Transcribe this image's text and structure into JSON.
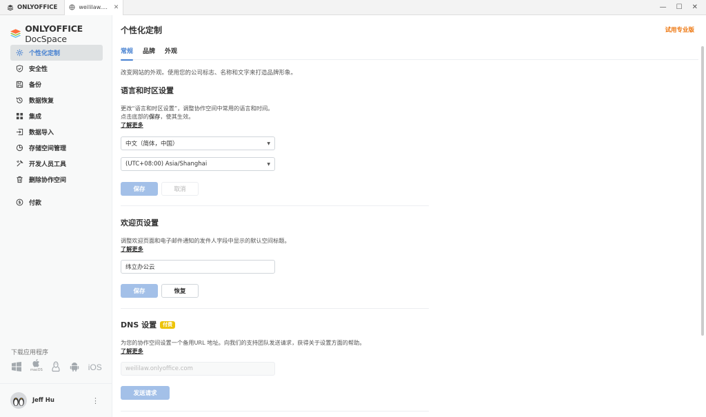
{
  "titlebar": {
    "app_name": "ONLYOFFICE",
    "tab_title": "weililaw.onlyo...",
    "tab_close": "✕",
    "min": "—",
    "max": "☐",
    "close": "✕"
  },
  "sidebar": {
    "logo_bold": "ONLYOFFICE",
    "logo_light": "DocSpace",
    "items": [
      {
        "label": "个性化定制",
        "icon": "gear-icon"
      },
      {
        "label": "安全性",
        "icon": "shield-icon"
      },
      {
        "label": "备份",
        "icon": "floppy-icon"
      },
      {
        "label": "数据恢复",
        "icon": "restore-icon"
      },
      {
        "label": "集成",
        "icon": "grid-icon"
      },
      {
        "label": "数据导入",
        "icon": "import-icon"
      },
      {
        "label": "存储空间管理",
        "icon": "storage-icon"
      },
      {
        "label": "开发人员工具",
        "icon": "tools-icon"
      },
      {
        "label": "删除协作空间",
        "icon": "trash-icon"
      },
      {
        "label": "付款",
        "icon": "payment-icon"
      }
    ],
    "download_label": "下载应用程序",
    "macos_label": "macOS",
    "ios_label": "iOS",
    "user_name": "Jeff Hu",
    "user_menu": "⋮"
  },
  "main": {
    "page_title": "个性化定制",
    "trial_link": "试用专业版",
    "tabs": [
      "常规",
      "品牌",
      "外观"
    ],
    "intro": "改变网站的外观。使用您的公司标志、名称和文字来打造品牌形象。",
    "language": {
      "title": "语言和时区设置",
      "desc_line1": "更改“语言和时区设置”，调整协作空间中常用的语言和时间。",
      "desc_line2_pre": "点击底部的",
      "desc_line2_bold": "保存",
      "desc_line2_post": "，使其生效。",
      "learn_more": "了解更多",
      "language_value": "中文（简体，中国）",
      "timezone_value": "(UTC+08:00) Asia/Shanghai",
      "save": "保存",
      "cancel": "取消"
    },
    "welcome": {
      "title": "欢迎页设置",
      "desc": "调整欢迎页面和电子邮件通知的发件人字段中显示的默认空间标题。",
      "learn_more": "了解更多",
      "value": "纬立办公云",
      "save": "保存",
      "restore": "恢复"
    },
    "dns": {
      "title": "DNS 设置",
      "badge": "付费",
      "desc": "为您的协作空间设置一个备用URL 地址。向我们的支持团队发送请求，获得关于设置方面的帮助。",
      "learn_more": "了解更多",
      "placeholder": "weililaw.onlyoffice.com",
      "send": "发送请求"
    }
  },
  "colors": {
    "accent": "#4781d1",
    "trial": "#ed7309",
    "badge": "#edc409",
    "primary_button": "#a3c0e8"
  }
}
